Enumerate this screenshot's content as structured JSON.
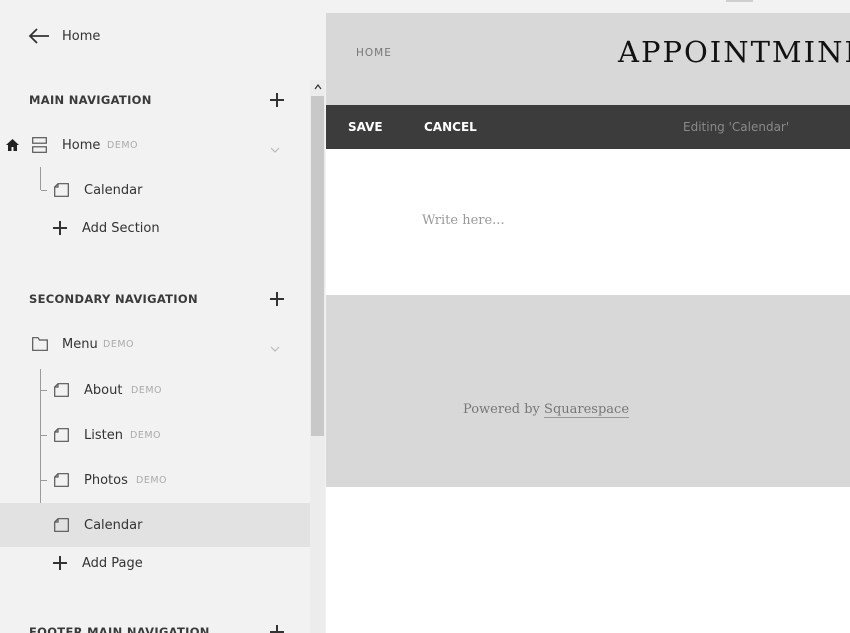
{
  "sidebar": {
    "back_label": "Home",
    "main_nav": {
      "title": "MAIN NAVIGATION",
      "items": [
        {
          "label": "Home",
          "badge": "DEMO"
        },
        {
          "label": "Calendar"
        }
      ],
      "add_label": "Add Section"
    },
    "secondary_nav": {
      "title": "SECONDARY NAVIGATION",
      "items": [
        {
          "label": "Menu",
          "badge": "DEMO"
        },
        {
          "label": "About",
          "badge": "DEMO"
        },
        {
          "label": "Listen",
          "badge": "DEMO"
        },
        {
          "label": "Photos",
          "badge": "DEMO"
        },
        {
          "label": "Calendar"
        }
      ],
      "add_label": "Add Page"
    },
    "footer_nav": {
      "title": "FOOTER MAIN NAVIGATION"
    }
  },
  "preview": {
    "nav_label": "HOME",
    "site_title": "APPOINTMIND",
    "save_label": "SAVE",
    "cancel_label": "CANCEL",
    "status": "Editing 'Calendar'",
    "placeholder": "Write here...",
    "powered_prefix": "Powered by",
    "powered_link": "Squarespace"
  },
  "colors": {
    "sidebar_bg": "#f2f2f2",
    "edit_bar": "#3c3c3c",
    "header_bg": "#d8d8d8",
    "selected_row": "#e2e2e2"
  }
}
